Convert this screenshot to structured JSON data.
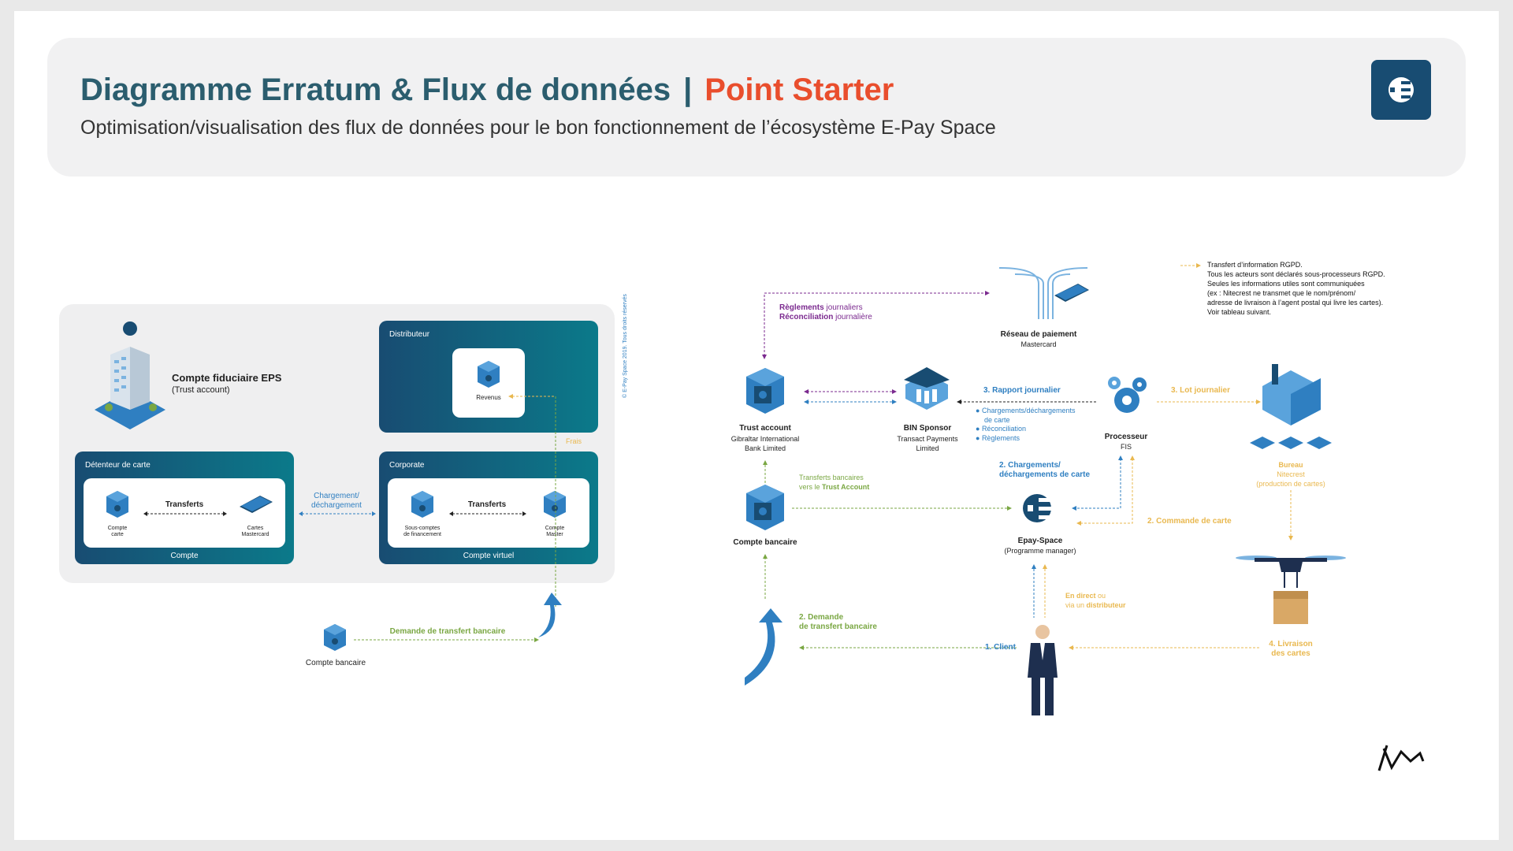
{
  "header": {
    "title": "Diagramme Erratum & Flux de données",
    "separator": "|",
    "title_accent": "Point Starter",
    "subtitle": "Optimisation/visualisation des flux de données pour le bon fonctionnement de l’écosystème E-Pay Space"
  },
  "left": {
    "trust_title": "Compte fiduciaire EPS",
    "trust_sub": "(Trust account)",
    "distributeur": "Distributeur",
    "revenus": "Revenus",
    "frais": "Frais",
    "detenteur": "Détenteur de carte",
    "transferts": "Transferts",
    "compte_carte_1": "Compte",
    "compte_carte_2": "carte",
    "cartes_1": "Cartes",
    "cartes_2": "Mastercard",
    "compte_footer": "Compte",
    "chargement_1": "Chargement/",
    "chargement_2": "déchargement",
    "corporate": "Corporate",
    "sous_comptes_1": "Sous-comptes",
    "sous_comptes_2": "de financement",
    "compte_master_1": "Compte",
    "compte_master_2": "Master",
    "compte_virtuel": "Compte virtuel",
    "copyright": "© E-Pay Space 2019. Tous droits réservés",
    "demande": "Demande de transfert bancaire",
    "compte_bancaire": "Compte bancaire"
  },
  "right": {
    "reglements": "Règlements",
    "reglements_rest": " journaliers",
    "reconciliation": "Réconciliation",
    "reconciliation_rest": " journalière",
    "reseau_title": "Réseau de paiement",
    "reseau_sub": "Mastercard",
    "rgpd": [
      "Transfert d’information RGPD.",
      "Tous les acteurs sont déclarés sous-processeurs RGPD.",
      "Seules les informations utiles sont communiquées",
      "(ex : Nitecrest ne transmet que le nom/prénom/",
      "adresse de livraison à l’agent postal qui livre les cartes).",
      "Voir tableau suivant."
    ],
    "trust_title": "Trust account",
    "trust_sub_1": "Gibraltar International",
    "trust_sub_2": "Bank Limited",
    "bin_title": "BIN Sponsor",
    "bin_sub_1": "Transact Payments",
    "bin_sub_2": "Limited",
    "rapport": "3. Rapport journalier",
    "bullets": [
      "Chargements/déchargements",
      "de carte",
      "Réconciliation",
      "Règlements"
    ],
    "processeur": "Processeur",
    "fis": "FIS",
    "lot": "3. Lot journalier",
    "bureau": "Bureau",
    "nitecrest": "Nitecrest",
    "production": "(production de cartes)",
    "transferts_1": "Transferts bancaires",
    "transferts_2": "vers le ",
    "transferts_bold": "Trust Account",
    "chargements_1": "2. Chargements/",
    "chargements_2": "déchargements de carte",
    "commande": "2. Commande de carte",
    "compte_bancaire": "Compte bancaire",
    "epay_title": "Epay-Space",
    "epay_sub": "(Programme manager)",
    "direct_1": "En direct",
    "direct_ou": " ou",
    "direct_2": "via un ",
    "direct_bold": "distributeur",
    "demande_1": "2. Demande",
    "demande_2": "de transfert bancaire",
    "client": "1. Client",
    "livraison_1": "4. Livraison",
    "livraison_2": "des cartes"
  },
  "colors": {
    "navy": "#184c72",
    "teal": "#0b7a8a",
    "orange": "#e94e2d",
    "blue": "#2f7fc1",
    "green": "#7aa743",
    "yellow": "#e9b84f",
    "purple": "#7b2a8f"
  }
}
